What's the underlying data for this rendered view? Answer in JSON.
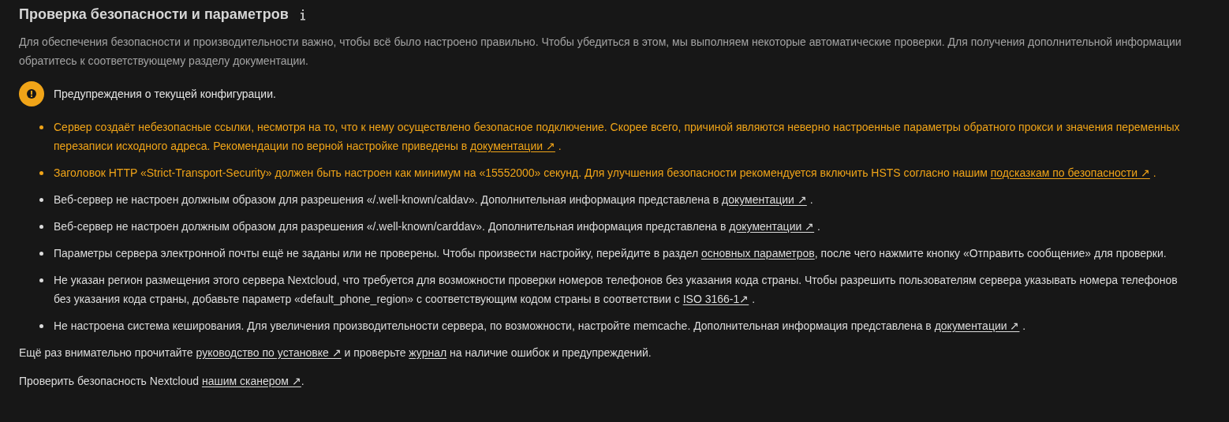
{
  "section": {
    "title": "Проверка безопасности и параметров",
    "description": "Для обеспечения безопасности и производительности важно, чтобы всё было настроено правильно. Чтобы убедиться в этом, мы выполняем некоторые автоматические проверки. Для получения дополнительной информации обратитесь к соответствующему разделу документации."
  },
  "warnings": {
    "heading": "Предупреждения о текущей конфигурации.",
    "items": [
      {
        "color": "#f0a418",
        "segments": [
          {
            "kind": "text",
            "text": "Сервер создаёт небезопасные ссылки, несмотря на то, что к нему осуществлено безопасное подключение. Скорее всего, причиной являются неверно настроенные параметры обратного прокси и значения переменных перезаписи исходного адреса. Рекомендации по верной настройке приведены в "
          },
          {
            "kind": "link",
            "text": "документации ↗"
          },
          {
            "kind": "text",
            "text": " ."
          }
        ]
      },
      {
        "color": "#f0a418",
        "segments": [
          {
            "kind": "text",
            "text": "Заголовок HTTP «Strict-Transport-Security» должен быть настроен как минимум на «15552000» секунд. Для улучшения безопасности рекомендуется включить HSTS согласно нашим "
          },
          {
            "kind": "link",
            "text": "подсказкам по безопасности ↗"
          },
          {
            "kind": "text",
            "text": " ."
          }
        ]
      },
      {
        "color": "#dcdcdc",
        "segments": [
          {
            "kind": "text",
            "text": "Веб-сервер не настроен должным образом для разрешения «/.well-known/caldav». Дополнительная информация представлена в "
          },
          {
            "kind": "link",
            "text": "документации ↗"
          },
          {
            "kind": "text",
            "text": " ."
          }
        ]
      },
      {
        "color": "#dcdcdc",
        "segments": [
          {
            "kind": "text",
            "text": "Веб-сервер не настроен должным образом для разрешения «/.well-known/carddav». Дополнительная информация представлена в "
          },
          {
            "kind": "link",
            "text": "документации ↗"
          },
          {
            "kind": "text",
            "text": " ."
          }
        ]
      },
      {
        "color": "#dcdcdc",
        "segments": [
          {
            "kind": "text",
            "text": "Параметры сервера электронной почты ещё не заданы или не проверены. Чтобы произвести настройку, перейдите в раздел "
          },
          {
            "kind": "link",
            "text": "основных параметров"
          },
          {
            "kind": "text",
            "text": ", после чего нажмите кнопку «Отправить сообщение» для проверки."
          }
        ]
      },
      {
        "color": "#dcdcdc",
        "segments": [
          {
            "kind": "text",
            "text": "Не указан регион размещения этого сервера Nextcloud, что требуется для возможности проверки номеров телефонов без указания кода страны. Чтобы разрешить пользователям сервера указывать номера телефонов без указания кода страны, добавьте параметр «default_phone_region» с соответствующим кодом страны в соответствии с "
          },
          {
            "kind": "link",
            "text": "ISO 3166-1↗"
          },
          {
            "kind": "text",
            "text": " ."
          }
        ]
      },
      {
        "color": "#dcdcdc",
        "segments": [
          {
            "kind": "text",
            "text": "Не настроена система кеширования. Для увеличения производительности сервера, по возможности, настройте memcache. Дополнительная информация представлена в "
          },
          {
            "kind": "link",
            "text": "документации ↗"
          },
          {
            "kind": "text",
            "text": " ."
          }
        ]
      }
    ]
  },
  "footer": [
    {
      "segments": [
        {
          "kind": "text",
          "text": "Ещё раз внимательно прочитайте "
        },
        {
          "kind": "link",
          "text": "руководство по установке ↗"
        },
        {
          "kind": "text",
          "text": " и проверьте "
        },
        {
          "kind": "link",
          "text": "журнал"
        },
        {
          "kind": "text",
          "text": " на наличие ошибок и предупреждений."
        }
      ]
    },
    {
      "segments": [
        {
          "kind": "text",
          "text": "Проверить безопасность Nextcloud "
        },
        {
          "kind": "link",
          "text": "нашим сканером ↗"
        },
        {
          "kind": "text",
          "text": "."
        }
      ]
    }
  ]
}
